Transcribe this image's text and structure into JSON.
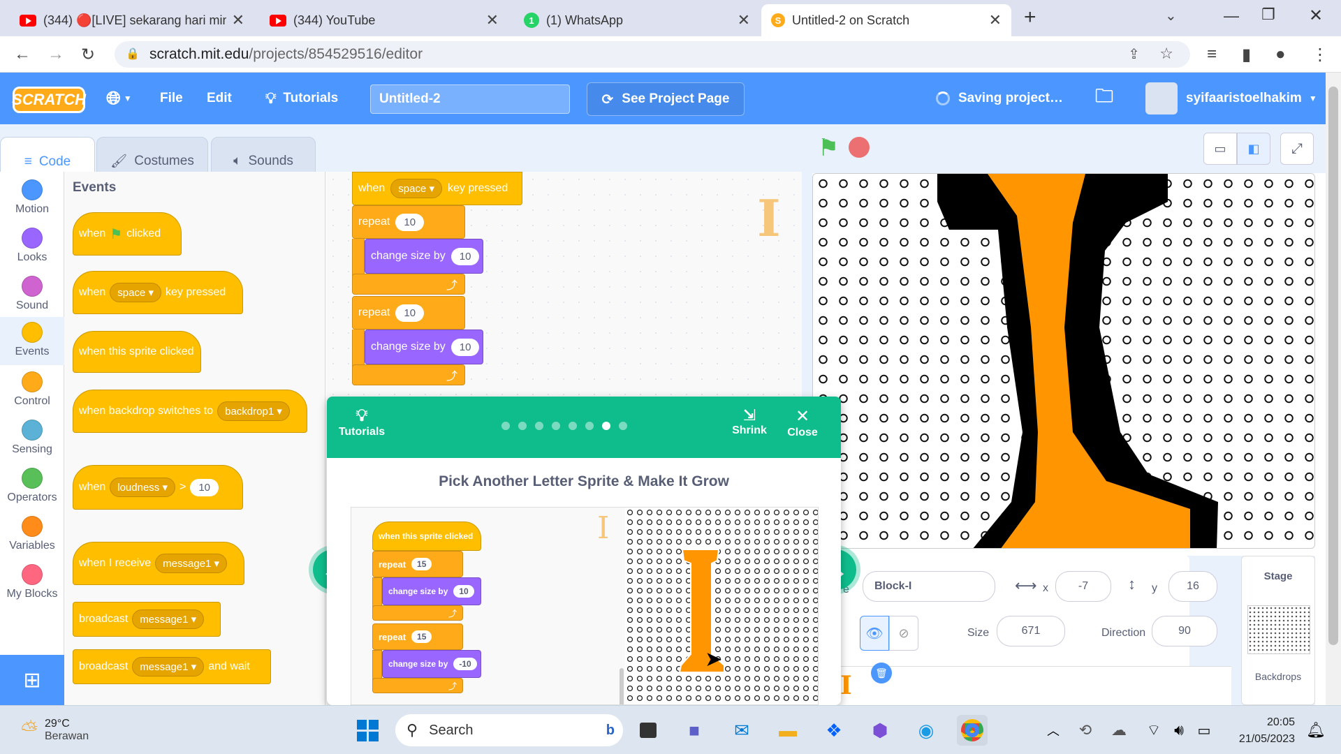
{
  "browser": {
    "tabs": [
      {
        "title": "(344) 🔴[LIVE] sekarang hari min",
        "icon": "youtube-icon"
      },
      {
        "title": "(344) YouTube",
        "icon": "youtube-icon"
      },
      {
        "title": "(1) WhatsApp",
        "icon": "whatsapp-icon"
      },
      {
        "title": "Untitled-2 on Scratch",
        "icon": "scratch-icon"
      }
    ],
    "url_host": "scratch.mit.edu",
    "url_path": "/projects/854529516/editor"
  },
  "menubar": {
    "logo": "SCRATCH",
    "file": "File",
    "edit": "Edit",
    "tutorials": "Tutorials",
    "project_title": "Untitled-2",
    "see_project": "See Project Page",
    "saving": "Saving project…",
    "username": "syifaaristoelhakim"
  },
  "editor_tabs": {
    "code": "Code",
    "costumes": "Costumes",
    "sounds": "Sounds"
  },
  "categories": [
    {
      "label": "Motion",
      "color": "#4c97ff"
    },
    {
      "label": "Looks",
      "color": "#9966ff"
    },
    {
      "label": "Sound",
      "color": "#cf63cf"
    },
    {
      "label": "Events",
      "color": "#ffbf00"
    },
    {
      "label": "Control",
      "color": "#ffab19"
    },
    {
      "label": "Sensing",
      "color": "#5cb1d6"
    },
    {
      "label": "Operators",
      "color": "#59c059"
    },
    {
      "label": "Variables",
      "color": "#ff8c1a"
    },
    {
      "label": "My Blocks",
      "color": "#ff6680"
    }
  ],
  "palette": {
    "heading": "Events",
    "b1": {
      "a": "when",
      "b": "clicked"
    },
    "b2": {
      "a": "when",
      "key": "space",
      "b": "key pressed"
    },
    "b3": "when this sprite clicked",
    "b4": {
      "a": "when backdrop switches to",
      "opt": "backdrop1"
    },
    "b5": {
      "a": "when",
      "opt": "loudness",
      "op": ">",
      "val": "10"
    },
    "b6": {
      "a": "when I receive",
      "opt": "message1"
    },
    "b7": {
      "a": "broadcast",
      "opt": "message1"
    },
    "b8": {
      "a": "broadcast",
      "opt": "message1",
      "b": "and wait"
    }
  },
  "script": {
    "hat": {
      "a": "when",
      "key": "space",
      "b": "key pressed"
    },
    "repeat1": {
      "label": "repeat",
      "val": "10"
    },
    "change1": {
      "label": "change size by",
      "val": "10"
    },
    "repeat2": {
      "label": "repeat",
      "val": "10"
    },
    "change2": {
      "label": "change size by",
      "val": "10"
    }
  },
  "tutorial": {
    "tutorials": "Tutorials",
    "shrink": "Shrink",
    "close": "Close",
    "title": "Pick Another Letter Sprite & Make It Grow",
    "hat": "when this sprite clicked",
    "repeat1": {
      "label": "repeat",
      "val": "15"
    },
    "change1": {
      "label": "change size by",
      "val": "10"
    },
    "repeat2": {
      "label": "repeat",
      "val": "15"
    },
    "change2": {
      "label": "change size by",
      "val": "-10"
    },
    "steps_total": 8,
    "step_current": 7
  },
  "sprite": {
    "name": "Block-I",
    "x_label": "x",
    "x": "-7",
    "y_label": "y",
    "y": "16",
    "size_label": "Size",
    "size": "671",
    "direction_label": "Direction",
    "direction": "90",
    "show_label": "ow",
    "sprite_label": "e"
  },
  "stage_panel": {
    "title": "Stage",
    "backdrops": "Backdrops"
  },
  "taskbar": {
    "temp": "29°C",
    "weather": "Berawan",
    "search": "Search",
    "time": "20:05",
    "date": "21/05/2023"
  }
}
